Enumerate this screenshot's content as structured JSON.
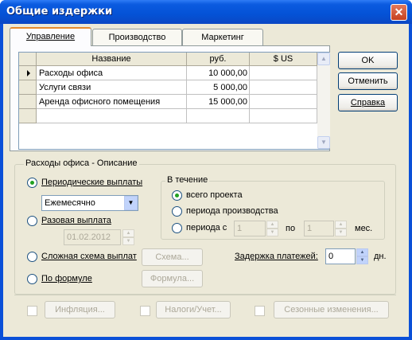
{
  "window": {
    "title": "Общие издержки",
    "close_glyph": "✕"
  },
  "tabs": [
    {
      "label": "Управление"
    },
    {
      "label": "Производство"
    },
    {
      "label": "Маркетинг"
    }
  ],
  "grid": {
    "columns": [
      "Название",
      "руб.",
      "$ US"
    ],
    "rows": [
      {
        "name": "Расходы офиса",
        "rub": "10 000,00",
        "usd": ""
      },
      {
        "name": "Услуги связи",
        "rub": "5 000,00",
        "usd": ""
      },
      {
        "name": "Аренда офисного помещения",
        "rub": "15 000,00",
        "usd": ""
      },
      {
        "name": "",
        "rub": "",
        "usd": ""
      }
    ],
    "current_row_icon": "row-pointer-icon"
  },
  "buttons": {
    "ok": "OK",
    "cancel": "Отменить",
    "help": "Справка"
  },
  "description": {
    "title": "Расходы офиса - Описание",
    "periodic_label": "Периодические выплаты",
    "period_select": "Ежемесячно",
    "single_label": "Разовая выплата",
    "single_date": "01.02.2012",
    "complex_label": "Сложная схема выплат",
    "scheme_button": "Схема...",
    "formula_label": "По формуле",
    "formula_button": "Формула..."
  },
  "during": {
    "title": "В течение",
    "whole": "всего проекта",
    "production": "периода производства",
    "period_from": "периода с",
    "from_value": "1",
    "to_label": "по",
    "to_value": "1",
    "months": "мес."
  },
  "delay": {
    "label": "Задержка платежей:",
    "value": "0",
    "unit": "дн."
  },
  "bottom": {
    "inflation": "Инфляция...",
    "taxes": "Налоги/Учет...",
    "seasonal": "Сезонные изменения..."
  },
  "colors": {
    "titlebar": "#0452d6",
    "dialog": "#ece9d8",
    "active_tab_accent": "#e68b2c"
  }
}
